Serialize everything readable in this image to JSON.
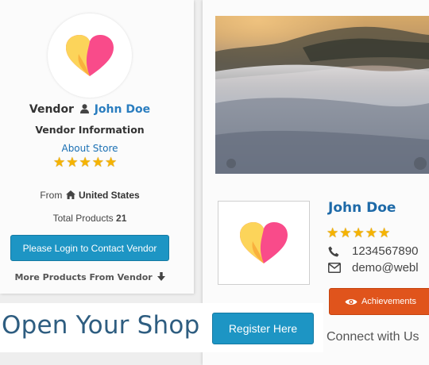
{
  "vendor_card": {
    "vendor_label": "Vendor",
    "vendor_name": "John Doe",
    "vendor_info_heading": "Vendor Information",
    "about_store_link": "About Store",
    "rating_stars": 5,
    "from_label": "From",
    "country": "United States",
    "total_products_label": "Total Products",
    "total_products_count": "21",
    "login_button": "Please Login to Contact Vendor",
    "more_products_link": "More Products From Vendor"
  },
  "store_panel": {
    "store_name": "John Doe",
    "rating_stars": 5,
    "phone": "1234567890",
    "email_visible": "demo@webl",
    "achievements_button": "Achievements",
    "connect_heading": "Connect with Us"
  },
  "promo": {
    "open_shop_text": "Open Your Shop",
    "register_button": "Register Here"
  },
  "icons": {
    "user": "user-icon",
    "home": "home-icon",
    "arrow_down": "arrow-down-icon",
    "phone": "phone-icon",
    "envelope": "envelope-icon",
    "eye": "eye-icon",
    "star": "star-icon",
    "logo": "heart-logo-icon"
  },
  "colors": {
    "link_blue": "#1a6fb3",
    "name_blue": "#2a7dbf",
    "button_blue": "#1d95c4",
    "achievement_orange": "#e0541c",
    "star_gold": "#f5b301",
    "heart_pink": "#f94b8a",
    "heart_yellow": "#fcd45a"
  }
}
